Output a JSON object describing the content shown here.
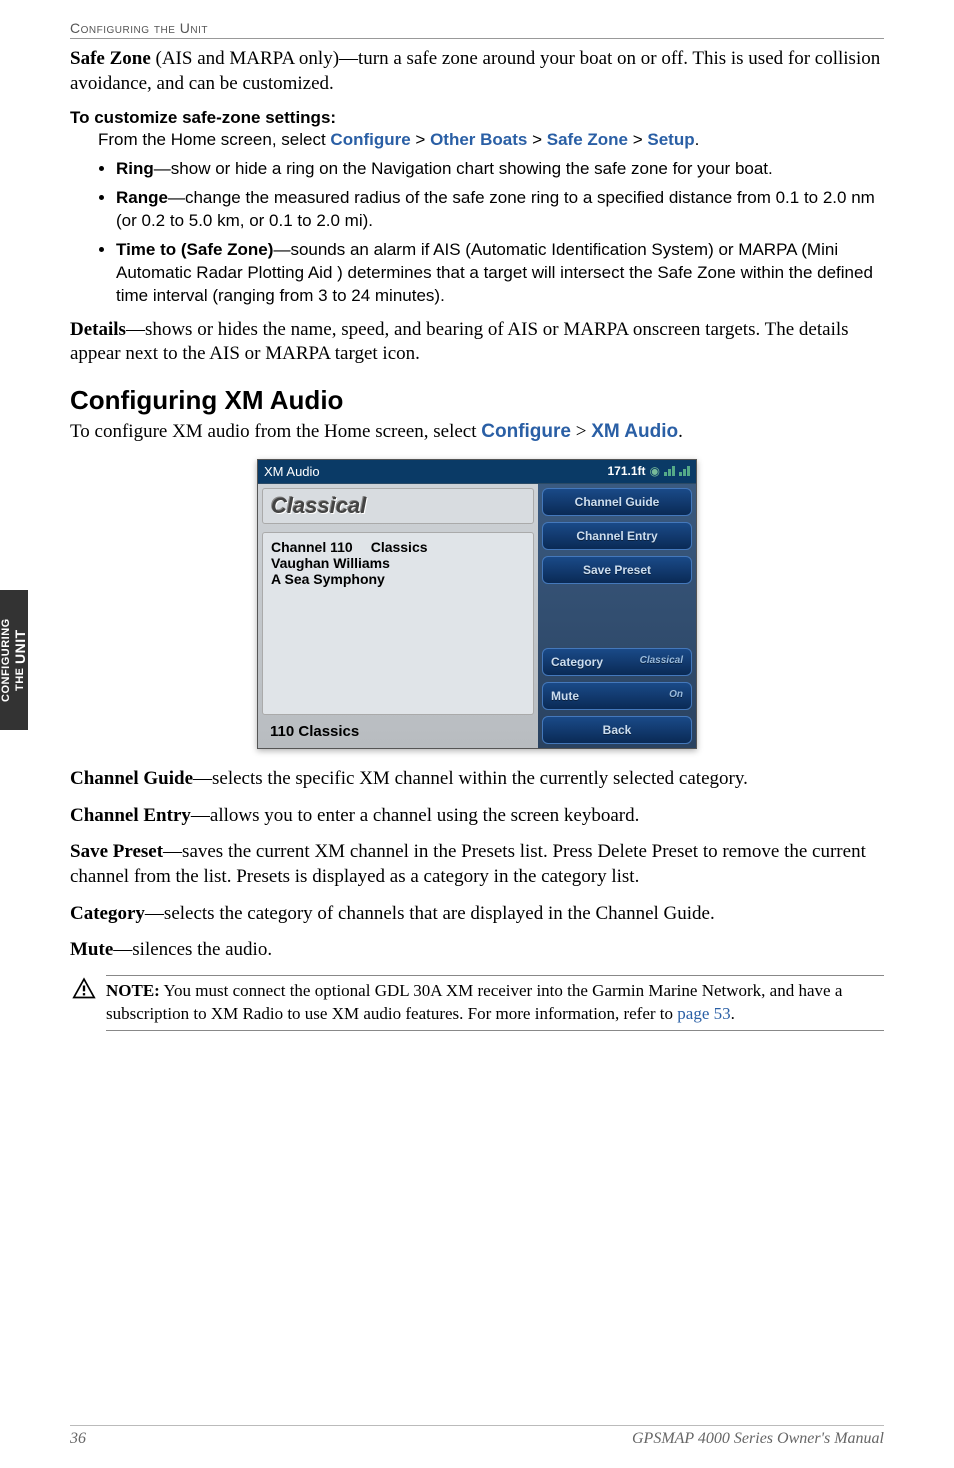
{
  "header": {
    "section": "Configuring the Unit"
  },
  "sidebar": {
    "line1": "Configuring",
    "line2": "the",
    "line3": "Unit"
  },
  "safezone": {
    "title": "Safe Zone",
    "title_note": " (AIS and MARPA only)—turn a safe zone around your boat on or off. This is used for collision avoidance, and can be customized.",
    "custom_heading": "To customize safe-zone settings:",
    "path_intro": "From the Home screen, select ",
    "p1": "Configure",
    "s1": " > ",
    "p2": "Other Boats",
    "s2": " > ",
    "p3": "Safe Zone",
    "s3": " > ",
    "p4": "Setup",
    "pend": ".",
    "bullets": [
      {
        "name": "Ring",
        "desc": "—show or hide a ring on the Navigation chart showing the safe zone for your boat."
      },
      {
        "name": "Range",
        "desc": "—change the measured radius of the safe zone ring to a specified distance from 0.1 to 2.0 nm (or 0.2 to 5.0 km, or 0.1 to 2.0 mi)."
      },
      {
        "name": "Time to (Safe Zone)",
        "desc": "—sounds an alarm if AIS (Automatic Identification System) or MARPA (Mini Automatic Radar Plotting Aid ) determines that a target will intersect the Safe Zone within the defined time interval (ranging from 3 to 24 minutes)."
      }
    ],
    "details_name": "Details",
    "details_desc": "—shows or hides the name, speed, and bearing of AIS or MARPA onscreen targets. The details appear next to the AIS or MARPA target icon."
  },
  "xm": {
    "heading": "Configuring XM Audio",
    "intro_a": "To configure XM audio from the Home screen, select ",
    "c1": "Configure",
    "s": " > ",
    "c2": "XM Audio",
    "end": ".",
    "screenshot": {
      "header_left": "XM Audio",
      "header_right": "171.1ft",
      "classical": "Classical",
      "channel_line": "Channel 110",
      "channel_cat": "Classics",
      "artist": "Vaughan Williams",
      "track": "A Sea Symphony",
      "bottom": "110 Classics",
      "btn_guide": "Channel Guide",
      "btn_entry": "Channel Entry",
      "btn_save": "Save Preset",
      "btn_cat": "Category",
      "btn_cat_val": "Classical",
      "btn_mute": "Mute",
      "btn_mute_val": "On",
      "btn_back": "Back"
    },
    "channel_guide": {
      "name": "Channel Guide",
      "desc": "—selects the specific XM channel within the currently selected category."
    },
    "channel_entry": {
      "name": "Channel Entry",
      "desc": "—allows you to enter a channel using the screen keyboard."
    },
    "save_preset": {
      "name": "Save Preset",
      "desc": "—saves the current XM channel in the Presets list. Press Delete Preset to remove the current channel from the list. Presets is displayed as a category in the category list."
    },
    "category": {
      "name": "Category",
      "desc": "—selects the category of channels that are displayed in the Channel Guide."
    },
    "mute": {
      "name": "Mute",
      "desc": "—silences the audio."
    },
    "note": {
      "label": "NOTE:",
      "text": " You must connect the optional GDL 30A XM receiver into the Garmin Marine Network, and have a subscription to XM Radio to use XM audio features. For more information, refer to ",
      "link": "page 53",
      "end": "."
    }
  },
  "footer": {
    "page": "36",
    "manual": "GPSMAP 4000 Series Owner's Manual"
  }
}
